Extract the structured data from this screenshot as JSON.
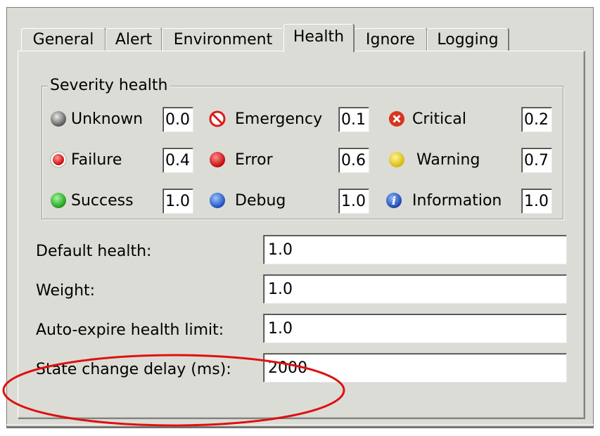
{
  "tabs": [
    {
      "label": "General"
    },
    {
      "label": "Alert"
    },
    {
      "label": "Environment"
    },
    {
      "label": "Health",
      "active": true
    },
    {
      "label": "Ignore"
    },
    {
      "label": "Logging"
    }
  ],
  "severity_health": {
    "title": "Severity health",
    "items": [
      {
        "label": "Unknown",
        "value": "0.0",
        "icon": "gray-ball-icon"
      },
      {
        "label": "Emergency",
        "value": "0.1",
        "icon": "prohibited-icon"
      },
      {
        "label": "Critical",
        "value": "0.2",
        "icon": "critical-x-icon"
      },
      {
        "label": "Failure",
        "value": "0.4",
        "icon": "failure-icon"
      },
      {
        "label": "Error",
        "value": "0.6",
        "icon": "red-ball-icon"
      },
      {
        "label": "Warning",
        "value": "0.7",
        "icon": "yellow-ball-icon"
      },
      {
        "label": "Success",
        "value": "1.0",
        "icon": "green-ball-icon"
      },
      {
        "label": "Debug",
        "value": "1.0",
        "icon": "blue-ball-icon"
      },
      {
        "label": "Information",
        "value": "1.0",
        "icon": "info-icon"
      }
    ]
  },
  "fields": {
    "default_health": {
      "label": "Default health:",
      "value": "1.0"
    },
    "weight": {
      "label": "Weight:",
      "value": "1.0"
    },
    "auto_expire": {
      "label": "Auto-expire health limit:",
      "value": "1.0"
    },
    "state_change_delay": {
      "label": "State change delay (ms):",
      "value": "2000"
    }
  },
  "colors": {
    "annotation": "#dd1111",
    "window_bg": "#dcdcd6"
  }
}
